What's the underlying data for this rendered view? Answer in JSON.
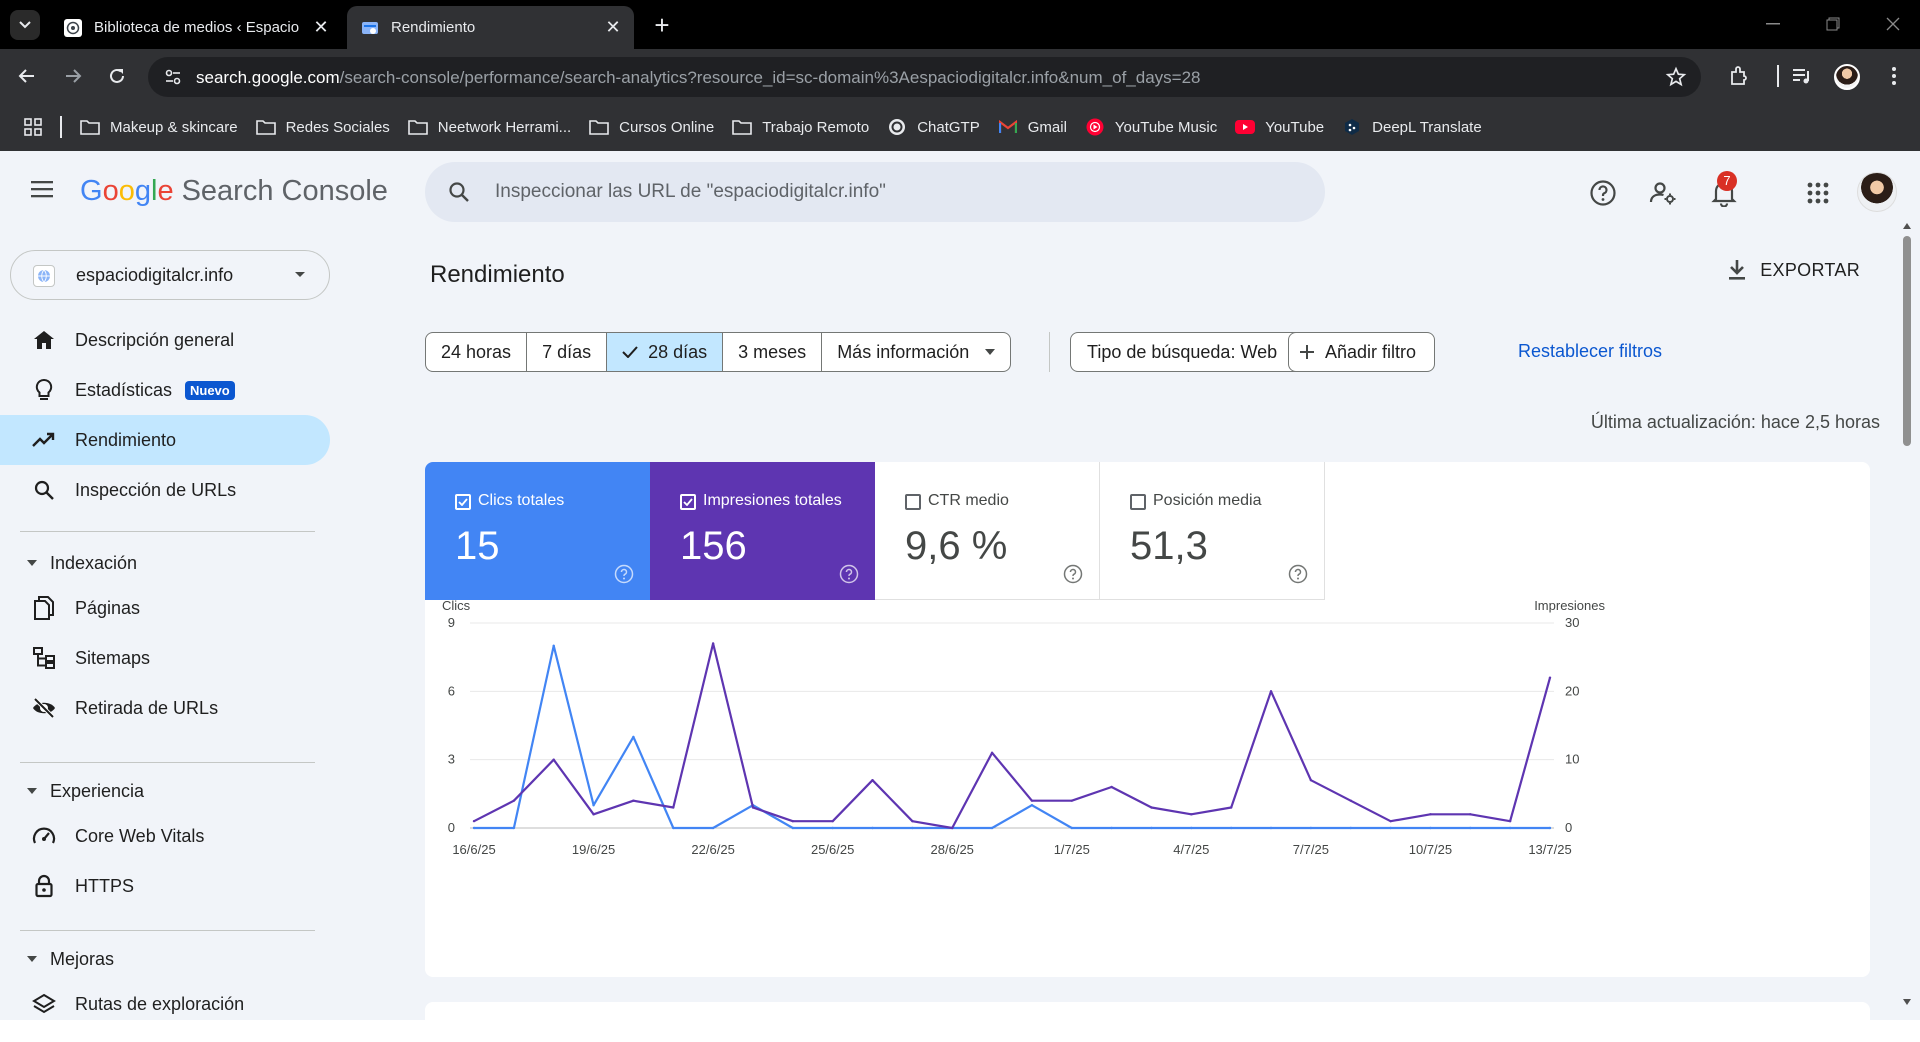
{
  "browser": {
    "tabs": [
      {
        "title": "Biblioteca de medios ‹ Espacio",
        "active": false
      },
      {
        "title": "Rendimiento",
        "active": true
      }
    ],
    "url_host": "search.google.com",
    "url_path": "/search-console/performance/search-analytics?resource_id=sc-domain%3Aespaciodigitalcr.info&num_of_days=28",
    "bookmarks": [
      {
        "label": "Makeup & skincare",
        "icon": "folder-icon"
      },
      {
        "label": "Redes Sociales",
        "icon": "folder-icon"
      },
      {
        "label": "Neetwork Herrami...",
        "icon": "folder-icon"
      },
      {
        "label": "Cursos Online",
        "icon": "folder-icon"
      },
      {
        "label": "Trabajo Remoto",
        "icon": "folder-icon"
      },
      {
        "label": "ChatGTP",
        "icon": "chatgpt-icon"
      },
      {
        "label": "Gmail",
        "icon": "gmail-icon"
      },
      {
        "label": "YouTube Music",
        "icon": "youtube-music-icon"
      },
      {
        "label": "YouTube",
        "icon": "youtube-icon"
      },
      {
        "label": "DeepL Translate",
        "icon": "deepl-icon"
      }
    ]
  },
  "app": {
    "logo_google": "Google",
    "logo_product": "Search Console",
    "search_placeholder": "Inspeccionar las URL de \"espaciodigitalcr.info\"",
    "notifications_count": "7"
  },
  "sidebar": {
    "property": "espaciodigitalcr.info",
    "items": [
      {
        "label": "Descripción general",
        "icon": "home-icon"
      },
      {
        "label": "Estadísticas",
        "icon": "lightbulb-icon",
        "badge": "Nuevo"
      },
      {
        "label": "Rendimiento",
        "icon": "trending-up-icon",
        "active": true
      },
      {
        "label": "Inspección de URLs",
        "icon": "search-icon"
      }
    ],
    "sections": [
      {
        "label": "Indexación",
        "items": [
          {
            "label": "Páginas",
            "icon": "pages-icon"
          },
          {
            "label": "Sitemaps",
            "icon": "sitemap-icon"
          },
          {
            "label": "Retirada de URLs",
            "icon": "visibility-off-icon"
          }
        ]
      },
      {
        "label": "Experiencia",
        "items": [
          {
            "label": "Core Web Vitals",
            "icon": "speed-icon"
          },
          {
            "label": "HTTPS",
            "icon": "lock-icon"
          }
        ]
      },
      {
        "label": "Mejoras",
        "items": [
          {
            "label": "Rutas de exploración",
            "icon": "layers-icon"
          }
        ]
      }
    ]
  },
  "main": {
    "title": "Rendimiento",
    "export_label": "EXPORTAR",
    "date_ranges": [
      "24 horas",
      "7 días",
      "28 días",
      "3 meses",
      "Más información"
    ],
    "selected_range": "28 días",
    "search_type": "Tipo de búsqueda: Web",
    "add_filter": "Añadir filtro",
    "reset_filters": "Restablecer filtros",
    "last_update": "Última actualización: hace 2,5 horas",
    "metrics": {
      "clicks": {
        "label": "Clics totales",
        "value": "15",
        "checked": true,
        "color": "#4285f4"
      },
      "impressions": {
        "label": "Impresiones totales",
        "value": "156",
        "checked": true,
        "color": "#5e35b1"
      },
      "ctr": {
        "label": "CTR medio",
        "value": "9,6 %",
        "checked": false
      },
      "position": {
        "label": "Posición media",
        "value": "51,3",
        "checked": false
      }
    }
  },
  "chart_data": {
    "type": "line",
    "y_left_label": "Clics",
    "y_right_label": "Impresiones",
    "y_left_ticks": [
      "9",
      "6",
      "3",
      "0"
    ],
    "y_right_ticks": [
      "30",
      "20",
      "10",
      "0"
    ],
    "ylim_left": [
      0,
      9
    ],
    "ylim_right": [
      0,
      30
    ],
    "x_tick_labels": [
      "16/6/25",
      "19/6/25",
      "22/6/25",
      "25/6/25",
      "28/6/25",
      "1/7/25",
      "4/7/25",
      "7/7/25",
      "10/7/25",
      "13/7/25"
    ],
    "x": [
      "16/6/25",
      "17/6/25",
      "18/6/25",
      "19/6/25",
      "20/6/25",
      "21/6/25",
      "22/6/25",
      "23/6/25",
      "24/6/25",
      "25/6/25",
      "26/6/25",
      "27/6/25",
      "28/6/25",
      "29/6/25",
      "30/6/25",
      "1/7/25",
      "2/7/25",
      "3/7/25",
      "4/7/25",
      "5/7/25",
      "6/7/25",
      "7/7/25",
      "8/7/25",
      "9/7/25",
      "10/7/25",
      "11/7/25",
      "12/7/25",
      "13/7/25"
    ],
    "grid": true,
    "series": [
      {
        "name": "Clics",
        "axis": "left",
        "color": "#4285f4",
        "values": [
          0,
          0,
          8,
          1,
          4,
          0,
          0,
          1,
          0,
          0,
          0,
          0,
          0,
          0,
          1,
          0,
          0,
          0,
          0,
          0,
          0,
          0,
          0,
          0,
          0,
          0,
          0,
          0
        ]
      },
      {
        "name": "Impresiones",
        "axis": "right",
        "color": "#5e35b1",
        "values": [
          1,
          4,
          10,
          2,
          4,
          3,
          27,
          3,
          1,
          1,
          7,
          1,
          0,
          11,
          4,
          4,
          6,
          3,
          2,
          3,
          20,
          7,
          4,
          1,
          2,
          2,
          1,
          22
        ]
      }
    ]
  }
}
